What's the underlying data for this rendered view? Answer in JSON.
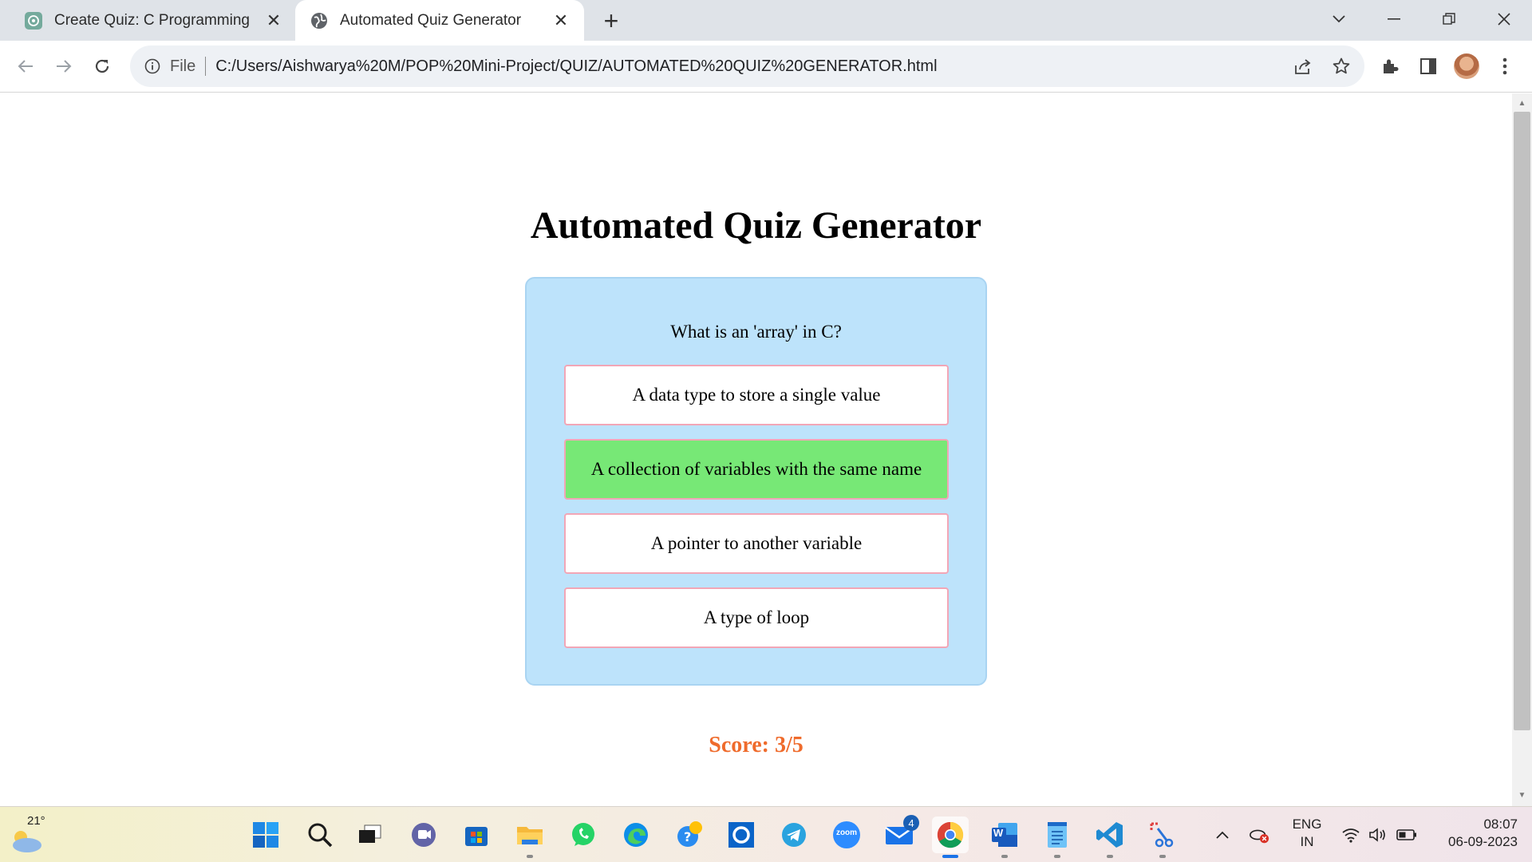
{
  "browser": {
    "tabs": [
      {
        "title": "Create Quiz: C Programming",
        "active": false
      },
      {
        "title": "Automated Quiz Generator",
        "active": true
      }
    ],
    "new_tab_symbol": "+",
    "address": {
      "scheme_label": "File",
      "url": "C:/Users/Aishwarya%20M/POP%20Mini-Project/QUIZ/AUTOMATED%20QUIZ%20GENERATOR.html"
    }
  },
  "page": {
    "title": "Automated Quiz Generator",
    "question": "What is an 'array' in C?",
    "options": [
      {
        "label": "A data type to store a single value",
        "state": "default"
      },
      {
        "label": "A collection of variables with the same name",
        "state": "correct"
      },
      {
        "label": "A pointer to another variable",
        "state": "default"
      },
      {
        "label": "A type of loop",
        "state": "default"
      }
    ],
    "score": "Score: 3/5"
  },
  "colors": {
    "card_background": "#bde3fb",
    "option_border": "#f2a6b6",
    "correct_option": "#77e876",
    "score_text": "#ef6b2c"
  },
  "taskbar": {
    "weather_temp": "21°",
    "apps": [
      "start-icon",
      "search-icon",
      "task-view-icon",
      "teams-chat-icon",
      "microsoft-store-icon",
      "file-explorer-icon",
      "whatsapp-icon",
      "edge-icon",
      "help-icon",
      "cortana-icon",
      "telegram-icon",
      "zoom-icon",
      "mail-icon",
      "chrome-icon",
      "word-icon",
      "notepad-icon",
      "vscode-icon",
      "snipping-tool-icon"
    ],
    "zoom_label": "zoom",
    "word_label": "W",
    "mail_badge": "4",
    "language": "ENG",
    "region": "IN",
    "time": "08:07",
    "date": "06-09-2023"
  }
}
